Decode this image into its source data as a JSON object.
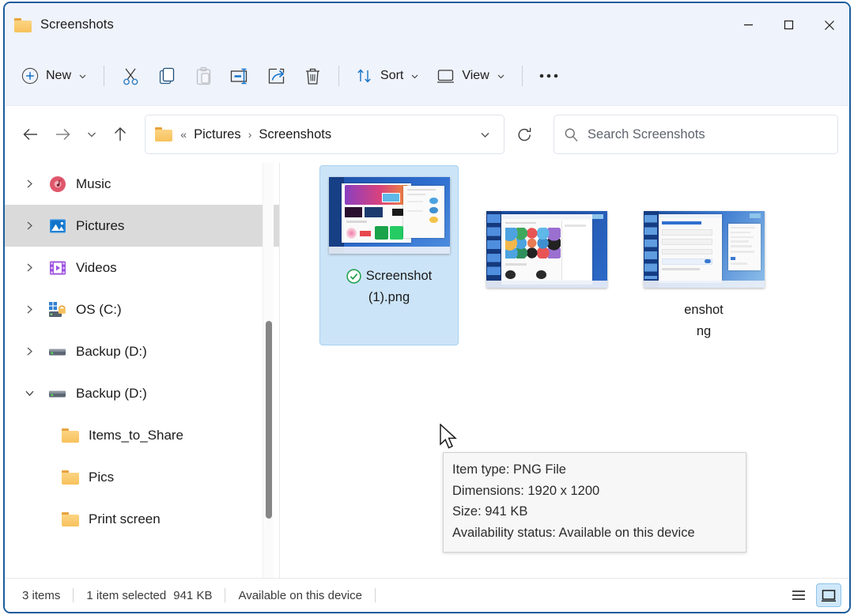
{
  "window": {
    "title": "Screenshots",
    "folder_icon": "folder-icon",
    "controls": {
      "minimize": "minimize-icon",
      "maximize": "maximize-icon",
      "close": "close-icon"
    }
  },
  "toolbar": {
    "new_label": "New",
    "sort_label": "Sort",
    "view_label": "View",
    "items": [
      {
        "name": "cut-icon",
        "label": "Cut",
        "disabled": false
      },
      {
        "name": "copy-icon",
        "label": "Copy",
        "disabled": false
      },
      {
        "name": "paste-icon",
        "label": "Paste",
        "disabled": true
      },
      {
        "name": "rename-icon",
        "label": "Rename",
        "disabled": false
      },
      {
        "name": "share-icon",
        "label": "Share",
        "disabled": false
      },
      {
        "name": "delete-icon",
        "label": "Delete",
        "disabled": false
      }
    ],
    "overflow_label": "•••"
  },
  "navigation": {
    "back_icon": "back-arrow-icon",
    "forward_icon": "forward-arrow-icon",
    "recent_icon": "chevron-down-icon",
    "up_icon": "up-arrow-icon",
    "refresh_icon": "refresh-icon",
    "breadcrumb": {
      "prefix": "«",
      "items": [
        "Pictures",
        "Screenshots"
      ],
      "separator": "›"
    }
  },
  "search": {
    "placeholder": "Search Screenshots",
    "icon": "search-icon"
  },
  "sidebar": {
    "items": [
      {
        "label": "Music",
        "icon": "music-icon",
        "expanded": false,
        "selected": false,
        "child": false
      },
      {
        "label": "Pictures",
        "icon": "pictures-icon",
        "expanded": false,
        "selected": true,
        "child": false
      },
      {
        "label": "Videos",
        "icon": "videos-icon",
        "expanded": false,
        "selected": false,
        "child": false
      },
      {
        "label": "OS (C:)",
        "icon": "os-drive-icon",
        "expanded": false,
        "selected": false,
        "child": false
      },
      {
        "label": "Backup (D:)",
        "icon": "drive-icon",
        "expanded": false,
        "selected": false,
        "child": false
      },
      {
        "label": "Backup (D:)",
        "icon": "drive-icon",
        "expanded": true,
        "selected": false,
        "child": false
      },
      {
        "label": "Items_to_Share",
        "icon": "folder-icon",
        "expanded": null,
        "selected": false,
        "child": true
      },
      {
        "label": "Pics",
        "icon": "folder-icon",
        "expanded": null,
        "selected": false,
        "child": true
      },
      {
        "label": "Print screen",
        "icon": "folder-icon",
        "expanded": null,
        "selected": false,
        "child": true
      }
    ]
  },
  "files": [
    {
      "name_line1": "Screenshot",
      "name_line2": "(1).png",
      "selected": true,
      "cloud_status": "available-on-device"
    },
    {
      "name_line1": "",
      "name_line2": "",
      "selected": false,
      "cloud_status": ""
    },
    {
      "name_line1": "enshot",
      "name_line2": "ng",
      "selected": false,
      "cloud_status": ""
    }
  ],
  "tooltip": {
    "lines": [
      "Item type: PNG File",
      "Dimensions: 1920 x 1200",
      "Size: 941 KB",
      "Availability status: Available on this device"
    ]
  },
  "statusbar": {
    "item_count": "3 items",
    "selection": "1 item selected",
    "selection_size": "941 KB",
    "availability": "Available on this device",
    "list_view_icon": "list-view-icon",
    "details_view_icon": "large-icons-view-icon"
  },
  "colors": {
    "chrome": "#eff3fb",
    "window_border": "#1b5c9c",
    "accent": "#0f6cbd",
    "selection": "#cce4f7",
    "sidebar_selected": "#dadada",
    "tooltip_bg": "#f7f7f7"
  }
}
